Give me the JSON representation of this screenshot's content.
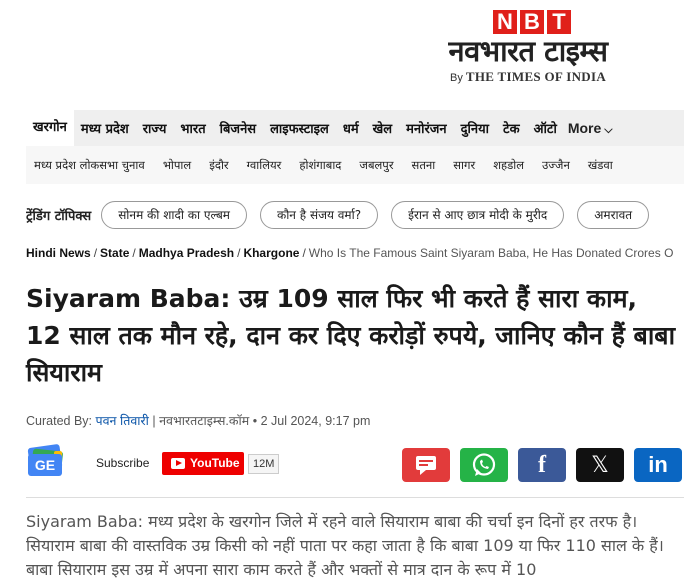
{
  "logo": {
    "letters": [
      "N",
      "B",
      "T"
    ],
    "hindi": "नवभारत टाइम्स",
    "by": "By",
    "times": "THE TIMES OF INDIA"
  },
  "nav_primary": {
    "items": [
      "खरगोन",
      "मध्य प्रदेश",
      "राज्य",
      "भारत",
      "बिजनेस",
      "लाइफस्टाइल",
      "धर्म",
      "खेल",
      "मनोरंजन",
      "दुनिया",
      "टेक",
      "ऑटो"
    ],
    "more": "More"
  },
  "nav_secondary": {
    "items": [
      "मध्य प्रदेश लोकसभा चुनाव",
      "भोपाल",
      "इंदौर",
      "ग्वालियर",
      "होशंगाबाद",
      "जबलपुर",
      "सतना",
      "सागर",
      "शहडोल",
      "उज्जैन",
      "खंडवा"
    ]
  },
  "trending": {
    "label": "ट्रेंडिंग टॉपिक्स",
    "topics": [
      "सोनम की शादी का एल्बम",
      "कौन है संजय वर्मा?",
      "ईरान से आए छात्र मोदी के मुरीद",
      "अमरावत"
    ]
  },
  "breadcrumb": {
    "items": [
      "Hindi News",
      "State",
      "Madhya Pradesh",
      "Khargone"
    ],
    "current": "Who Is The Famous Saint Siyaram Baba, He Has Donated Crores O"
  },
  "article": {
    "headline": "Siyaram Baba: उम्र 109 साल फिर भी करते हैं सारा काम, 12 साल तक मौन रहे, दान कर दिए करोड़ों रुपये, जानिए कौन हैं बाबा सियाराम",
    "curated_label": "Curated By:",
    "author": "पवन तिवारी",
    "source": "नवभारतटाइम्स.कॉम",
    "date": "2 Jul 2024, 9:17 pm",
    "body": "Siyaram Baba: मध्य प्रदेश के खरगोन जिले में रहने वाले सियाराम बाबा की चर्चा इन दिनों हर तरफ है। सियाराम बाबा की वास्तविक उम्र किसी को नहीं पाता पर कहा जाता है कि बाबा 109 या फिर 110 साल के हैं। बाबा सियाराम इस उम्र में अपना सारा काम करते हैं और भक्तों से मात्र दान के रूप में 10"
  },
  "social": {
    "gnews_label": "GE",
    "subscribe": "Subscribe",
    "youtube": "YouTube",
    "youtube_count": "12M",
    "facebook": "f",
    "x": "𝕏",
    "linkedin": "in"
  },
  "colors": {
    "brand_red": "#e0201a",
    "author_link": "#0b55a8",
    "whatsapp": "#25b347",
    "facebook": "#3b5998",
    "linkedin": "#0a66c2",
    "comment": "#e23b3b"
  }
}
